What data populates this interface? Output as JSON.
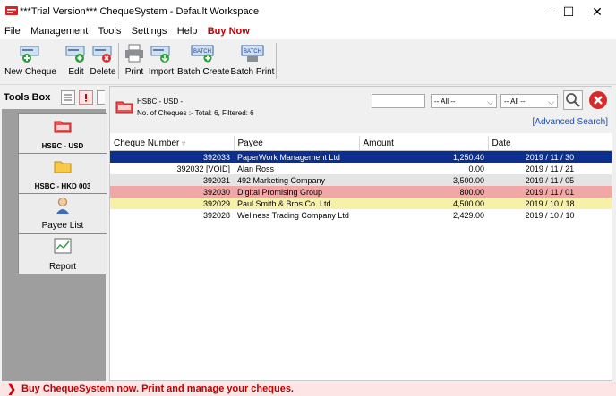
{
  "window": {
    "title": "***Trial Version*** ChequeSystem - Default Workspace",
    "controls": {
      "minimize": "–",
      "maximize": "☐",
      "close": "✕"
    }
  },
  "menu": {
    "items": [
      {
        "label": "File",
        "accel": "F"
      },
      {
        "label": "Management",
        "accel": "M"
      },
      {
        "label": "Tools",
        "accel": "T"
      },
      {
        "label": "Settings",
        "accel": "S"
      },
      {
        "label": "Help",
        "accel": "H"
      },
      {
        "label": "Buy Now",
        "accel": ""
      }
    ]
  },
  "toolbar": {
    "new_cheque": "New Cheque",
    "edit": "Edit",
    "delete": "Delete",
    "print": "Print",
    "import": "Import",
    "batch_create": "Batch Create",
    "batch_print": "Batch Print",
    "batch_icon_text": "BATCH"
  },
  "toolsbox": {
    "title": "Tools Box",
    "items": [
      {
        "label": "HSBC - USD",
        "icon": "red-folder-icon"
      },
      {
        "label": "HSBC - HKD 003",
        "icon": "yellow-folder-icon"
      },
      {
        "label": "Payee List",
        "icon": "person-icon"
      },
      {
        "label": "Report",
        "icon": "chart-icon"
      }
    ]
  },
  "account": {
    "name": "HSBC - USD -",
    "summary": "No. of Cheques :- Total: 6, Filtered: 6"
  },
  "search": {
    "text_value": "",
    "filter1": "-- All --",
    "filter2": "-- All --",
    "advanced_link": "[Advanced Search]"
  },
  "grid": {
    "headers": {
      "cheque_number": "Cheque Number",
      "payee": "Payee",
      "amount": "Amount",
      "date": "Date"
    },
    "rows": [
      {
        "cheque": "392033",
        "payee": "PaperWork Management Ltd",
        "amount": "1,250.40",
        "date": "2019 / 11 / 30",
        "status": "selected"
      },
      {
        "cheque": "392032 [VOID]",
        "payee": "Alan Ross",
        "amount": "0.00",
        "date": "2019 / 11 / 21",
        "status": "void"
      },
      {
        "cheque": "392031",
        "payee": "492 Marketing Company",
        "amount": "3,500.00",
        "date": "2019 / 11 / 05",
        "status": "grey"
      },
      {
        "cheque": "392030",
        "payee": "Digital Promising Group",
        "amount": "800.00",
        "date": "2019 / 11 / 01",
        "status": "red"
      },
      {
        "cheque": "392029",
        "payee": "Paul Smith & Bros Co. Ltd",
        "amount": "4,500.00",
        "date": "2019 / 10 / 18",
        "status": "yellow"
      },
      {
        "cheque": "392028",
        "payee": "Wellness Trading Company Ltd",
        "amount": "2,429.00",
        "date": "2019 / 10 / 10",
        "status": "plain"
      }
    ]
  },
  "status": {
    "arrow": "❯",
    "message": "Buy ChequeSystem now. Print and manage your cheques."
  }
}
